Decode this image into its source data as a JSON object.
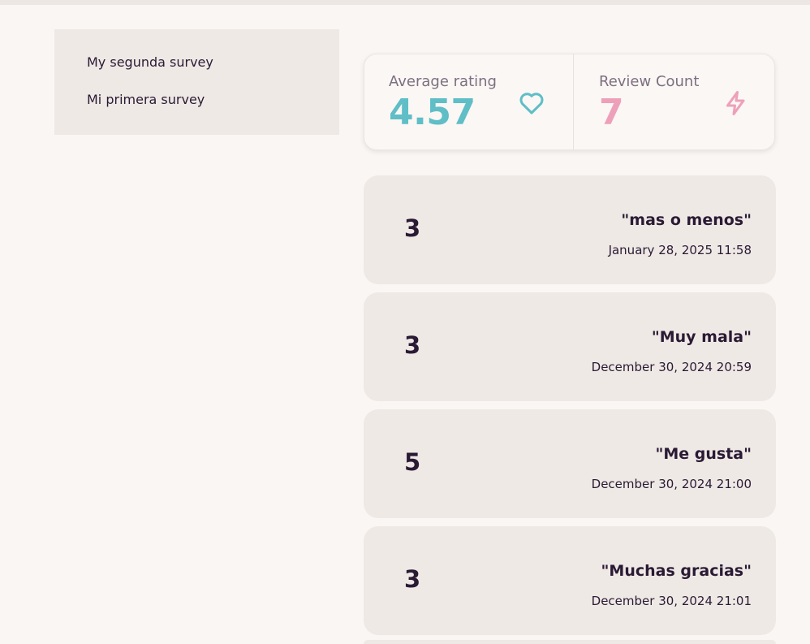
{
  "sidebar": {
    "items": [
      {
        "label": "My segunda survey"
      },
      {
        "label": "Mi primera survey"
      }
    ]
  },
  "stats": {
    "average": {
      "label": "Average rating",
      "value": "4.57",
      "icon": "heart-icon",
      "color": "#5fbec6"
    },
    "count": {
      "label": "Review Count",
      "value": "7",
      "icon": "lightning-icon",
      "color": "#eea0ba"
    }
  },
  "reviews": [
    {
      "rating": "3",
      "comment": "\"mas o menos\"",
      "date": "January 28, 2025 11:58"
    },
    {
      "rating": "3",
      "comment": "\"Muy mala\"",
      "date": "December 30, 2024 20:59"
    },
    {
      "rating": "5",
      "comment": "\"Me gusta\"",
      "date": "December 30, 2024 21:00"
    },
    {
      "rating": "3",
      "comment": "\"Muchas gracias\"",
      "date": "December 30, 2024 21:01"
    }
  ],
  "colors": {
    "background": "#f9f6f4",
    "panel": "#eee9e5",
    "text": "#2a1a34",
    "muted": "#7d6f7f"
  }
}
